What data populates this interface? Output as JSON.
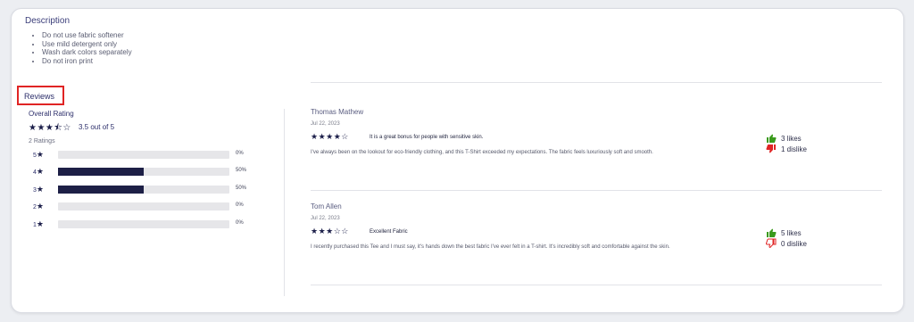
{
  "description": {
    "title": "Description",
    "items": [
      "Do not use fabric softener",
      "Use mild detergent only",
      "Wash dark colors separately",
      "Do not iron print"
    ]
  },
  "reviews_section": {
    "title": "Reviews",
    "overall_label": "Overall Rating",
    "overall_stars": "★★★⯪☆",
    "overall_value": "3.5 out of 5",
    "ratings_count": "2 Ratings",
    "breakdown": [
      {
        "label": "5",
        "percent_text": "0%",
        "fraction": 0.0
      },
      {
        "label": "4",
        "percent_text": "50%",
        "fraction": 0.5
      },
      {
        "label": "3",
        "percent_text": "50%",
        "fraction": 0.5
      },
      {
        "label": "2",
        "percent_text": "0%",
        "fraction": 0.0
      },
      {
        "label": "1",
        "percent_text": "0%",
        "fraction": 0.0
      }
    ],
    "star_glyph": "★"
  },
  "reviews": [
    {
      "name": "Thomas Mathew",
      "date": "Jul 22, 2023",
      "stars": "★★★★☆",
      "title": "It is a great bonus for people with sensitive skin.",
      "body": "I've always been on the lookout for eco-friendly clothing, and this T-Shirt exceeded my expectations. The fabric feels luxuriously soft and smooth.",
      "likes": "3 likes",
      "dislikes": "1 dislike",
      "liked": true,
      "disliked": true
    },
    {
      "name": "Tom Allen",
      "date": "Jul 22, 2023",
      "stars": "★★★☆☆",
      "title": "Excellent Fabric",
      "body": "I recently purchased this Tee and I must say, it's hands down the best fabric I've ever felt in a T-shirt. It's incredibly soft and comfortable against the skin.",
      "likes": "5 likes",
      "dislikes": "0 dislike",
      "liked": true,
      "disliked": false
    }
  ],
  "colors": {
    "like": "#3a9a1c",
    "dislike": "#e02424",
    "bar_fill": "#1d1f46"
  }
}
